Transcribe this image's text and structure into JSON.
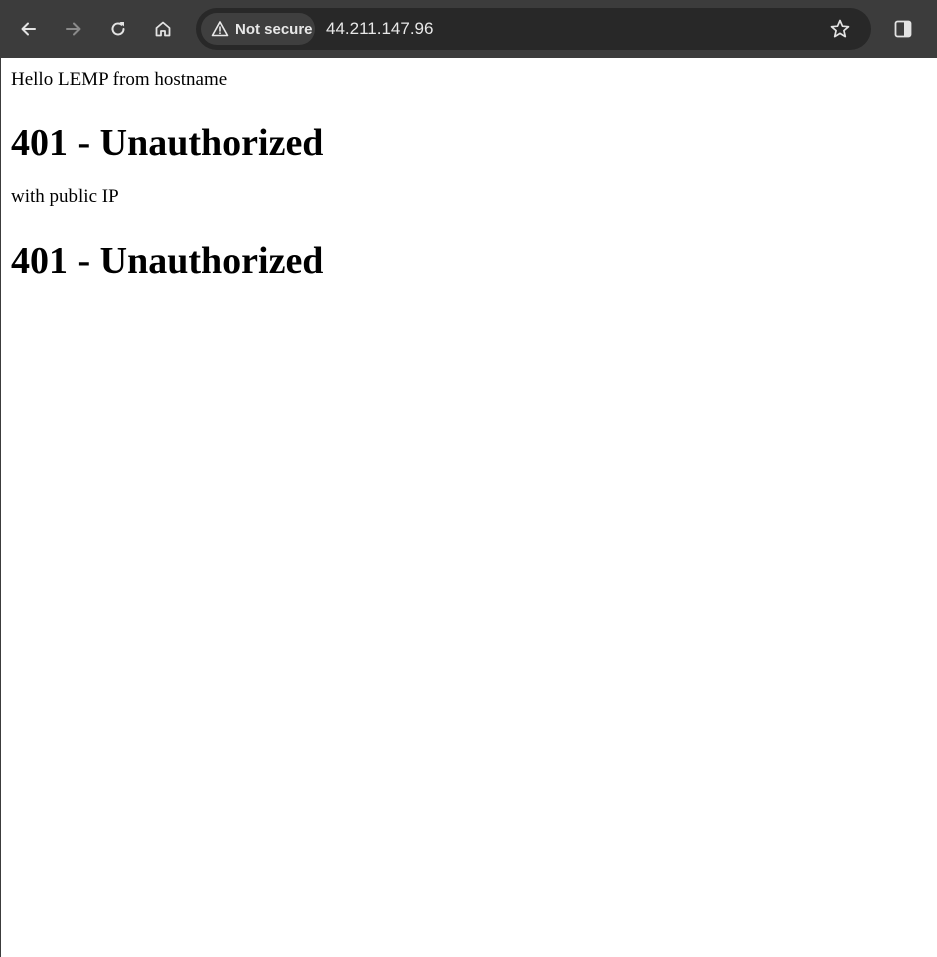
{
  "browser": {
    "security_label": "Not secure",
    "url": "44.211.147.96"
  },
  "icons": {
    "back": "back-arrow-icon",
    "forward": "forward-arrow-icon",
    "reload": "reload-icon",
    "home": "home-icon",
    "warning": "warning-triangle-icon",
    "bookmark": "star-icon",
    "side_panel": "side-panel-icon"
  },
  "colors": {
    "toolbar_bg": "#3c3c3c",
    "omnibox_bg": "#282828",
    "chip_bg": "#3f3f3f",
    "icon": "#e3e3e3",
    "icon_disabled": "#8a8a8a",
    "page_bg": "#ffffff"
  },
  "page": {
    "line1": "Hello LEMP from hostname",
    "heading1": "401 - Unauthorized",
    "line2": "with public IP",
    "heading2": "401 - Unauthorized"
  }
}
